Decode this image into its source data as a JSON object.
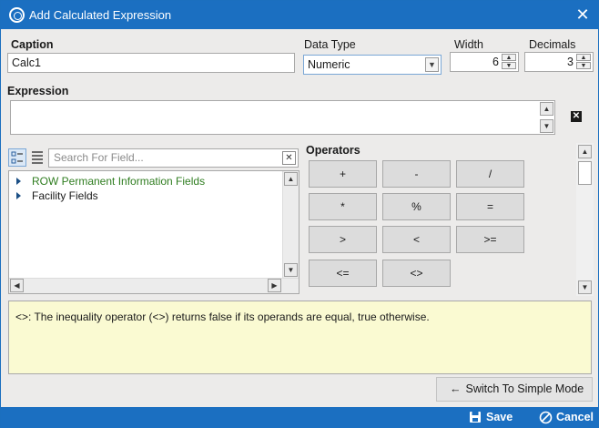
{
  "window": {
    "title": "Add Calculated Expression",
    "close_label": "✕"
  },
  "caption": {
    "label": "Caption",
    "value": "Calc1"
  },
  "data_type": {
    "label": "Data Type",
    "value": "Numeric"
  },
  "width": {
    "label": "Width",
    "value": "6"
  },
  "decimals": {
    "label": "Decimals",
    "value": "3"
  },
  "expression": {
    "label": "Expression",
    "value": ""
  },
  "field_search": {
    "placeholder": "Search For Field..."
  },
  "tree": {
    "items": [
      {
        "label": "ROW Permanent Information Fields"
      },
      {
        "label": "Facility Fields"
      }
    ]
  },
  "operators": {
    "label": "Operators",
    "items": [
      "+",
      "-",
      "/",
      "*",
      "%",
      "=",
      ">",
      "<",
      ">=",
      "<=",
      "<>"
    ]
  },
  "description": {
    "text": "<>: The inequality operator (<>) returns false if its operands are equal, true otherwise."
  },
  "switch_mode": {
    "label": "Switch To Simple Mode"
  },
  "footer": {
    "save_label": "Save",
    "cancel_label": "Cancel"
  },
  "colors": {
    "accent": "#1b6fc1",
    "tree_green": "#2f7d20",
    "description_bg": "#fafad2"
  }
}
